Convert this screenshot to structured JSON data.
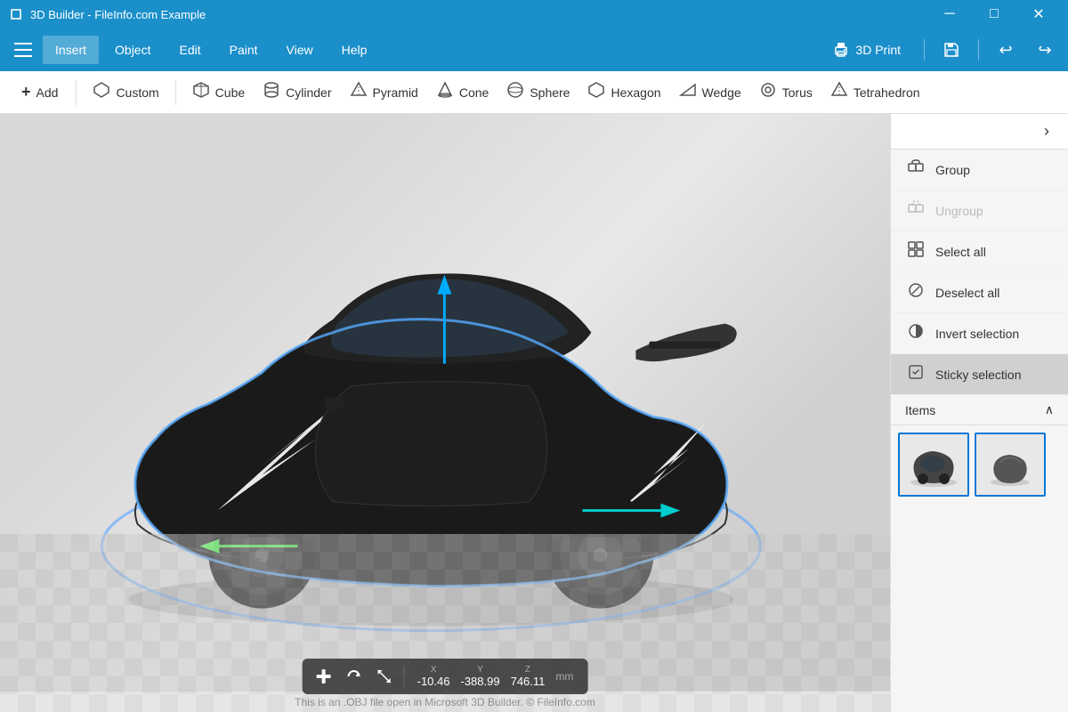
{
  "app": {
    "title": "3D Builder - FileInfo.com Example"
  },
  "titlebar": {
    "minimize_label": "─",
    "maximize_label": "□",
    "close_label": "✕"
  },
  "menubar": {
    "items": [
      "Insert",
      "Object",
      "Edit",
      "Paint",
      "View",
      "Help"
    ],
    "active": "Insert",
    "print_label": "3D Print",
    "undo_label": "↩",
    "redo_label": "↪"
  },
  "toolbar": {
    "add_label": "Add",
    "items": [
      {
        "id": "custom",
        "label": "Custom",
        "icon": "⬡"
      },
      {
        "id": "cube",
        "label": "Cube",
        "icon": "⬛"
      },
      {
        "id": "cylinder",
        "label": "Cylinder",
        "icon": "⬤"
      },
      {
        "id": "pyramid",
        "label": "Pyramid",
        "icon": "▲"
      },
      {
        "id": "cone",
        "label": "Cone",
        "icon": "△"
      },
      {
        "id": "sphere",
        "label": "Sphere",
        "icon": "○"
      },
      {
        "id": "hexagon",
        "label": "Hexagon",
        "icon": "⬡"
      },
      {
        "id": "wedge",
        "label": "Wedge",
        "icon": "◤"
      },
      {
        "id": "torus",
        "label": "Torus",
        "icon": "◎"
      },
      {
        "id": "tetrahedron",
        "label": "Tetrahedron",
        "icon": "△"
      }
    ]
  },
  "panel": {
    "toggle_icon": "›",
    "actions": [
      {
        "id": "group",
        "label": "Group",
        "icon": "group",
        "disabled": false
      },
      {
        "id": "ungroup",
        "label": "Ungroup",
        "icon": "ungroup",
        "disabled": true
      },
      {
        "id": "select-all",
        "label": "Select all",
        "disabled": false
      },
      {
        "id": "deselect-all",
        "label": "Deselect all",
        "disabled": false
      },
      {
        "id": "invert-selection",
        "label": "Invert selection",
        "disabled": false
      },
      {
        "id": "sticky-selection",
        "label": "Sticky selection",
        "active": true,
        "disabled": false
      }
    ],
    "items_label": "Items",
    "items_collapse_icon": "∧"
  },
  "statusbar": {
    "x_label": "X",
    "y_label": "Y",
    "z_label": "Z",
    "x_value": "-10.46",
    "y_value": "-388.99",
    "z_value": "746.11",
    "unit": "mm"
  },
  "bottom_text": "This is an .OBJ file open in Microsoft 3D Builder. © FileInfo.com"
}
